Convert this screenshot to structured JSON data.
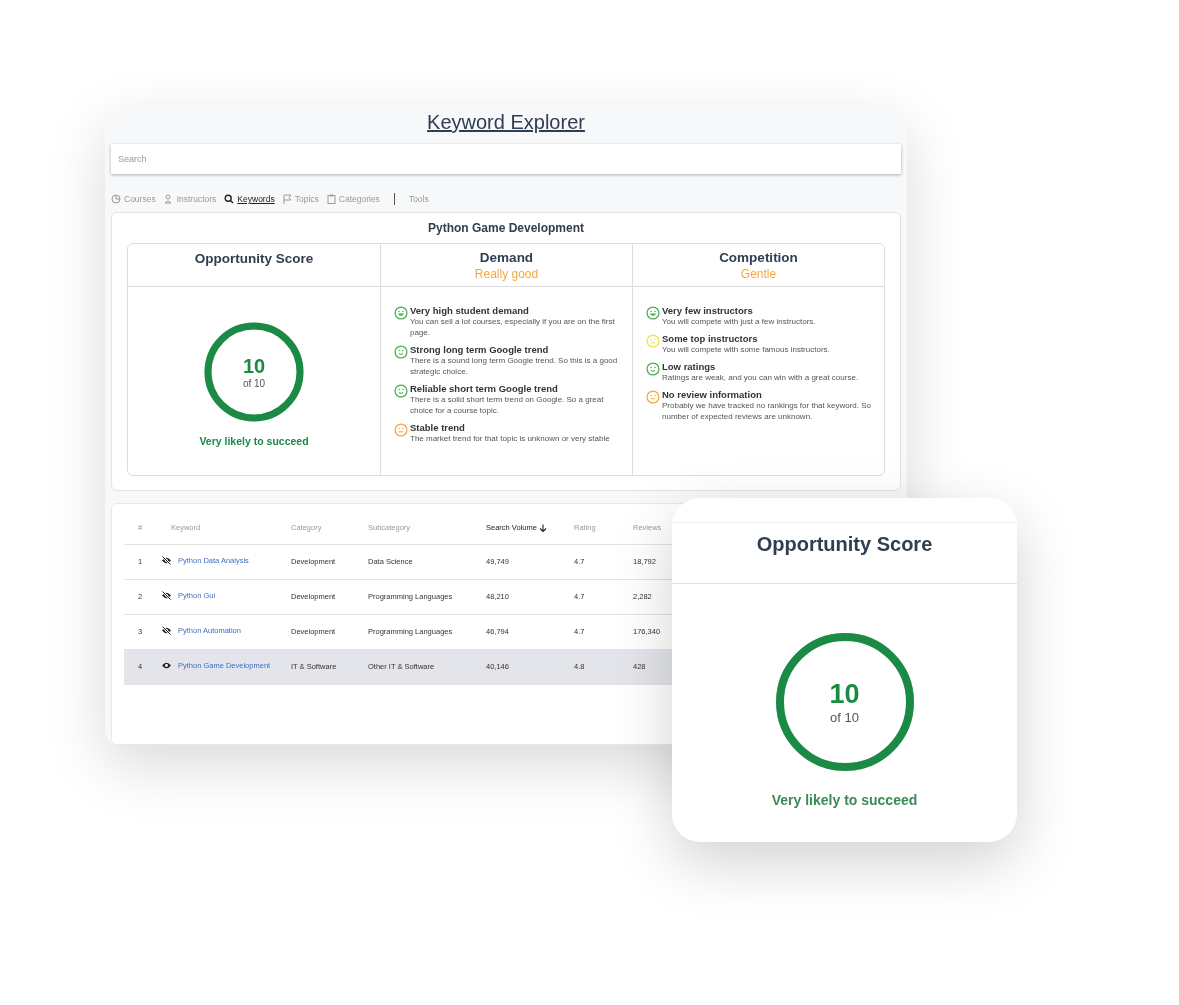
{
  "title": "Keyword Explorer",
  "search": {
    "placeholder": "Search"
  },
  "tabs": [
    {
      "label": "Courses",
      "selected": false
    },
    {
      "label": "Instructors",
      "selected": false
    },
    {
      "label": "Keywords",
      "selected": true
    },
    {
      "label": "Topics",
      "selected": false
    },
    {
      "label": "Categories",
      "selected": false
    },
    {
      "label": "Tools",
      "selected": false
    }
  ],
  "detail": {
    "title": "Python Game Development",
    "score": {
      "heading": "Opportunity Score",
      "value": "10",
      "of": "of 10",
      "level": 1,
      "verdict": "Very likely to succeed"
    },
    "columns": [
      {
        "heading": "Demand",
        "rating": "Really good",
        "items": [
          {
            "kind": "grin",
            "color": "#4caf50",
            "title": "Very high student demand",
            "text": "You can sell a lot courses, especially if you are on the first page."
          },
          {
            "kind": "smile",
            "color": "#4caf50",
            "title": "Strong long term Google trend",
            "text": "There is a sound long term Google trend. So this is a good strategic choice."
          },
          {
            "kind": "smile",
            "color": "#4caf50",
            "title": "Reliable short term Google trend",
            "text": "There is a solid short term trend on Google. So a great choice for a course topic."
          },
          {
            "kind": "neutral",
            "color": "#f5a742",
            "title": "Stable trend",
            "text": "The market trend for that topic is unknown or very stable"
          }
        ]
      },
      {
        "heading": "Competition",
        "rating": "Gentle",
        "items": [
          {
            "kind": "grin",
            "color": "#4caf50",
            "title": "Very few instructors",
            "text": "You will compete with just a few instructors."
          },
          {
            "kind": "sad",
            "color": "#f2e24a",
            "title": "Some top instructors",
            "text": "You will compete with some famous instructors."
          },
          {
            "kind": "smile",
            "color": "#4caf50",
            "title": "Low ratings",
            "text": "Ratings are weak, and you can win with a great course."
          },
          {
            "kind": "neutral",
            "color": "#f5a742",
            "title": "No review information",
            "text": "Probably we have tracked no rankings for that keyword. So number of expected reviews are unknown."
          }
        ]
      }
    ]
  },
  "table": {
    "columns": [
      {
        "label": "#",
        "sorted": false
      },
      {
        "label": "Keyword",
        "sorted": false
      },
      {
        "label": "Category",
        "sorted": false
      },
      {
        "label": "Subcategory",
        "sorted": false
      },
      {
        "label": "Search Volume",
        "sorted": true
      },
      {
        "label": "Rating",
        "sorted": false
      },
      {
        "label": "Reviews",
        "sorted": false
      }
    ],
    "rows": [
      {
        "index": "1",
        "hidden": true,
        "keyword": "Python Data Analysis",
        "category": "Development",
        "subcategory": "Data Science",
        "volume": "49,749",
        "rating": "4.7",
        "reviews": "18,792",
        "selected": false
      },
      {
        "index": "2",
        "hidden": true,
        "keyword": "Python Gui",
        "category": "Development",
        "subcategory": "Programming Languages",
        "volume": "48,210",
        "rating": "4.7",
        "reviews": "2,282",
        "selected": false
      },
      {
        "index": "3",
        "hidden": true,
        "keyword": "Python Automation",
        "category": "Development",
        "subcategory": "Programming Languages",
        "volume": "46,794",
        "rating": "4.7",
        "reviews": "176,340",
        "selected": false
      },
      {
        "index": "4",
        "hidden": false,
        "keyword": "Python Game Development",
        "category": "IT & Software",
        "subcategory": "Other IT & Software",
        "volume": "40,146",
        "rating": "4.8",
        "reviews": "428",
        "selected": true
      }
    ]
  },
  "popup": {
    "heading": "Opportunity Score",
    "value": "10",
    "of": "of 10",
    "level": 1,
    "verdict": "Very likely to succeed"
  }
}
